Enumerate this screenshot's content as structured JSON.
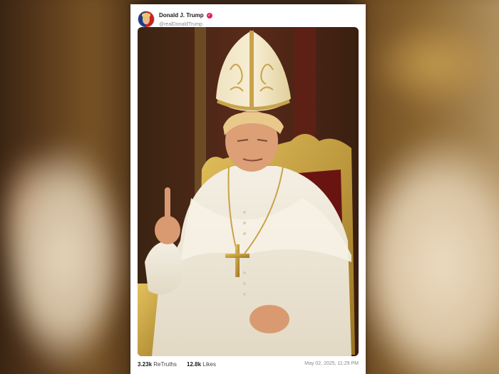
{
  "post": {
    "author_name": "Donald J. Trump",
    "author_handle": "@realDonaldTrump",
    "retruths_count": "3.23k",
    "retruths_label": "ReTruths",
    "likes_count": "12.8k",
    "likes_label": "Likes",
    "timestamp": "May 02, 2025, 11:29 PM"
  },
  "icons": {
    "verified": "verified-badge-icon",
    "avatar": "profile-avatar"
  },
  "colors": {
    "verified_badge": "#e0245e",
    "card_background": "#ffffff"
  }
}
